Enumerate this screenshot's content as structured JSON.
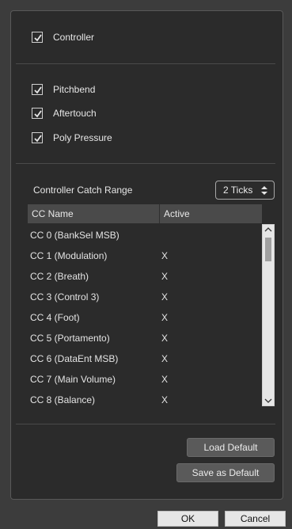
{
  "checkboxes": {
    "controller": {
      "label": "Controller",
      "checked": true
    },
    "pitchbend": {
      "label": "Pitchbend",
      "checked": true
    },
    "aftertouch": {
      "label": "Aftertouch",
      "checked": true
    },
    "poly_pressure": {
      "label": "Poly Pressure",
      "checked": true
    }
  },
  "catch_range": {
    "label": "Controller Catch Range",
    "value": "2 Ticks"
  },
  "table": {
    "headers": [
      "CC Name",
      "Active"
    ],
    "rows": [
      {
        "name": "CC 0  (BankSel MSB)",
        "active": ""
      },
      {
        "name": "CC 1  (Modulation)",
        "active": "X"
      },
      {
        "name": "CC 2  (Breath)",
        "active": "X"
      },
      {
        "name": "CC 3  (Control 3)",
        "active": "X"
      },
      {
        "name": "CC 4  (Foot)",
        "active": "X"
      },
      {
        "name": "CC 5  (Portamento)",
        "active": "X"
      },
      {
        "name": "CC 6  (DataEnt MSB)",
        "active": "X"
      },
      {
        "name": "CC 7  (Main Volume)",
        "active": "X"
      },
      {
        "name": "CC 8  (Balance)",
        "active": "X"
      }
    ]
  },
  "buttons": {
    "load_default": "Load Default",
    "save_as_default": "Save as Default",
    "ok": "OK",
    "cancel": "Cancel"
  }
}
